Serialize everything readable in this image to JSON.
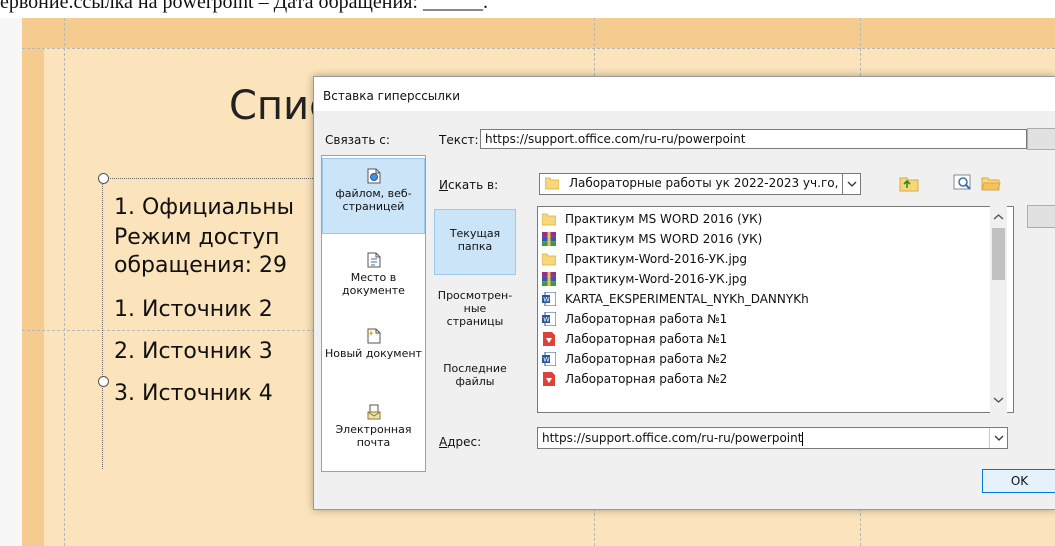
{
  "doc_line": "ервоние.ссылка на powerpoint  – Дата обращения: ______.",
  "slide": {
    "title": "Спис",
    "lines": [
      "1. Официальны",
      "Режим доступ",
      "обращения: 29",
      "1.   Источник 2",
      "2.   Источник 3",
      "3.   Источник 4"
    ]
  },
  "dialog": {
    "title": "Вставка гиперссылки",
    "link_to_label": "Связать с:",
    "text_label": "Текст:",
    "text_value": "https://support.office.com/ru-ru/powerpoint",
    "look_in_label": "Искать в:",
    "look_in_value": "Лабораторные работы ук 2022-2023 уч.го,",
    "link_to_items": [
      {
        "label": "файлом, веб-страницей",
        "icon": "file-web-icon"
      },
      {
        "label": "Место в документе",
        "icon": "place-in-document-icon"
      },
      {
        "label": "Новый документ",
        "icon": "new-document-icon"
      },
      {
        "label": "Электронная почта",
        "icon": "email-icon"
      }
    ],
    "subnav": [
      {
        "label": "Текущая папка"
      },
      {
        "label": "Просмотрен-ные страницы"
      },
      {
        "label": "Последние файлы"
      }
    ],
    "files": [
      {
        "name": "Практикум MS WORD 2016 (УК)",
        "icon": "folder-icon"
      },
      {
        "name": "Практикум MS WORD 2016 (УК)",
        "icon": "rar-icon"
      },
      {
        "name": "Практикум-Word-2016-УК.jpg",
        "icon": "folder-icon"
      },
      {
        "name": "Практикум-Word-2016-УК.jpg",
        "icon": "rar-icon"
      },
      {
        "name": "KARTA_EKSPERIMENTAL_NYKh_DANNYKh",
        "icon": "word-icon"
      },
      {
        "name": "Лабораторная работа №1",
        "icon": "word-icon"
      },
      {
        "name": "Лабораторная работа №1",
        "icon": "pdf-icon"
      },
      {
        "name": "Лабораторная работа №2",
        "icon": "word-icon"
      },
      {
        "name": "Лабораторная работа №2",
        "icon": "pdf-icon"
      }
    ],
    "address_label": "Адрес:",
    "address_value": "https://support.office.com/ru-ru/powerpoint",
    "ok_label": "OK"
  },
  "colors": {
    "slide_bg": "#fbe3bb",
    "slide_band": "#f5cb8f",
    "selection": "#cce4f7"
  }
}
